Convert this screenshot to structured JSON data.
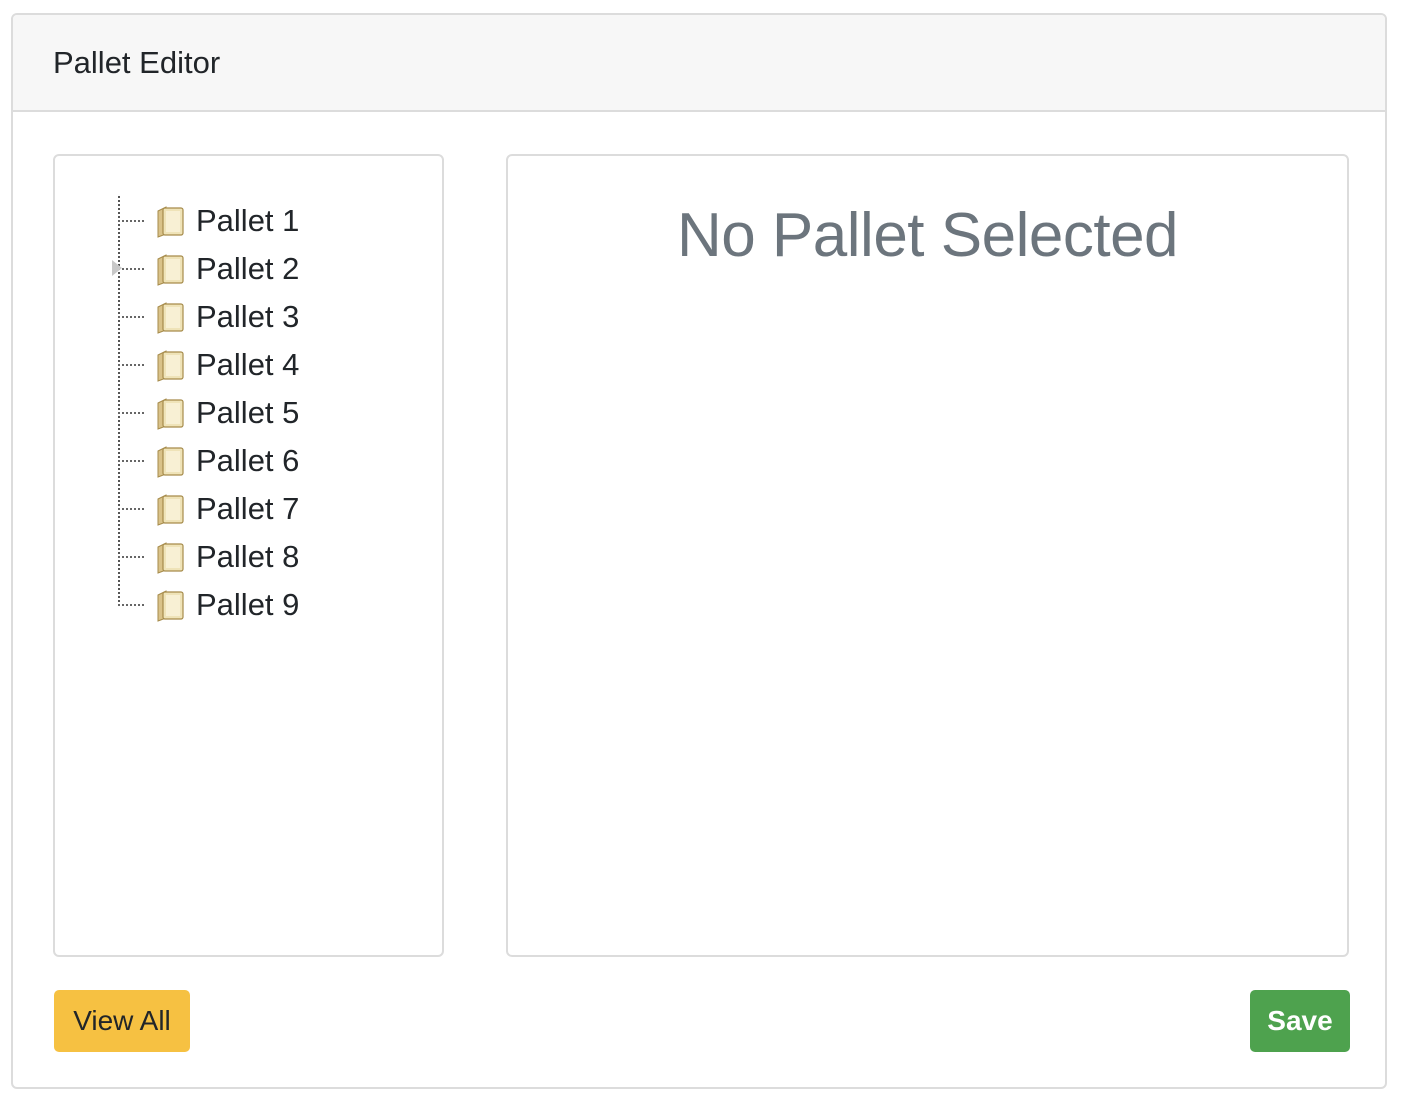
{
  "header": {
    "title": "Pallet Editor"
  },
  "tree": {
    "items": [
      {
        "label": "Pallet 1",
        "expandable": false
      },
      {
        "label": "Pallet 2",
        "expandable": true
      },
      {
        "label": "Pallet 3",
        "expandable": false
      },
      {
        "label": "Pallet 4",
        "expandable": false
      },
      {
        "label": "Pallet 5",
        "expandable": false
      },
      {
        "label": "Pallet 6",
        "expandable": false
      },
      {
        "label": "Pallet 7",
        "expandable": false
      },
      {
        "label": "Pallet 8",
        "expandable": false
      },
      {
        "label": "Pallet 9",
        "expandable": false
      }
    ],
    "icon": "folder-icon"
  },
  "detail": {
    "empty_message": "No Pallet Selected"
  },
  "footer": {
    "view_all_label": "View All",
    "save_label": "Save"
  },
  "colors": {
    "view_all_bg": "#f6c142",
    "save_bg": "#4ea24e",
    "empty_text": "#6c757d"
  }
}
